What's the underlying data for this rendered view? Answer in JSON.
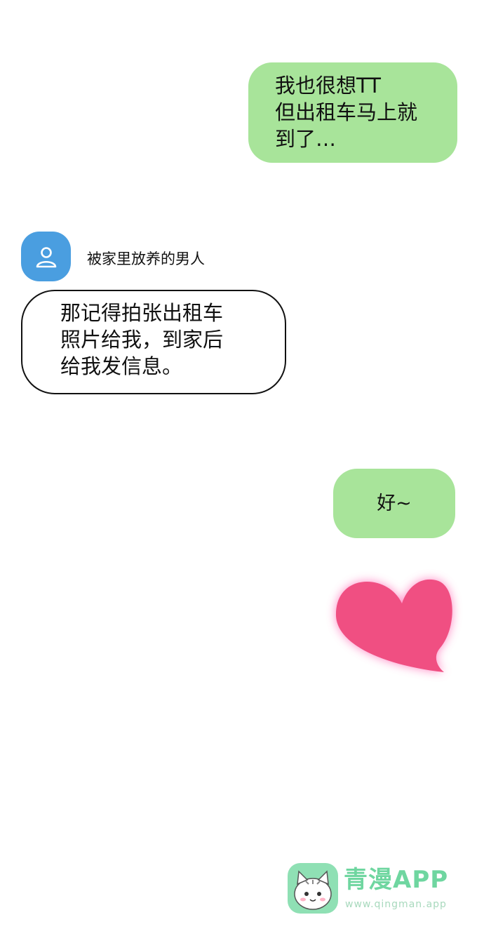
{
  "messages": {
    "msg1": {
      "sender": "me",
      "text": "我也很想TT\n但出租车马上就\n到了…"
    },
    "msg2": {
      "sender": "other",
      "text": "那记得拍张出租车\n照片给我，到家后\n给我发信息。"
    },
    "msg3": {
      "sender": "me",
      "text": "好~"
    }
  },
  "contact": {
    "name": "被家里放养的男人",
    "avatar_icon": "person-icon",
    "avatar_color": "#4a9ee0"
  },
  "sticker": {
    "icon": "heart-icon",
    "color": "#f04f82"
  },
  "colors": {
    "my_bubble": "#a8e49a",
    "other_bubble_border": "#111111",
    "background": "#ffffff"
  },
  "watermark": {
    "brand": "青漫APP",
    "url": "www.qingman.app",
    "logo_icon": "cat-icon"
  }
}
